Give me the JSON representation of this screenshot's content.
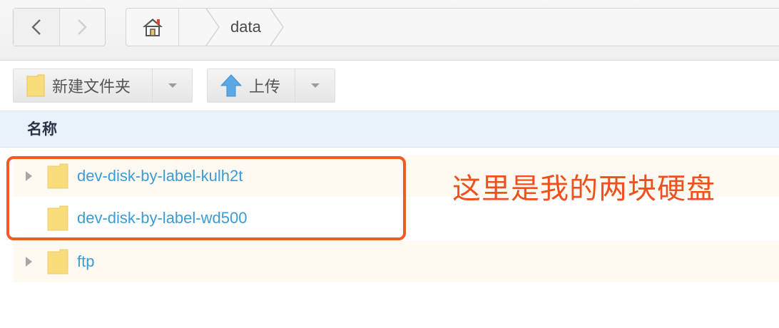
{
  "navigation": {
    "back_icon": "chevron-left-icon",
    "forward_icon": "chevron-right-icon"
  },
  "breadcrumb": {
    "home_icon": "home-icon",
    "items": [
      "data"
    ]
  },
  "toolbar": {
    "new_folder_label": "新建文件夹",
    "upload_label": "上传"
  },
  "file_list": {
    "column_name": "名称",
    "rows": [
      {
        "name": "dev-disk-by-label-kulh2t",
        "expandable": true
      },
      {
        "name": "dev-disk-by-label-wd500",
        "expandable": false
      },
      {
        "name": "ftp",
        "expandable": true
      }
    ]
  },
  "annotation": {
    "text": "这里是我的两块硬盘",
    "color": "#f0501e"
  },
  "colors": {
    "link": "#3a9bd5",
    "header_bg": "#e9f2fb",
    "folder": "#f9dc7c"
  }
}
